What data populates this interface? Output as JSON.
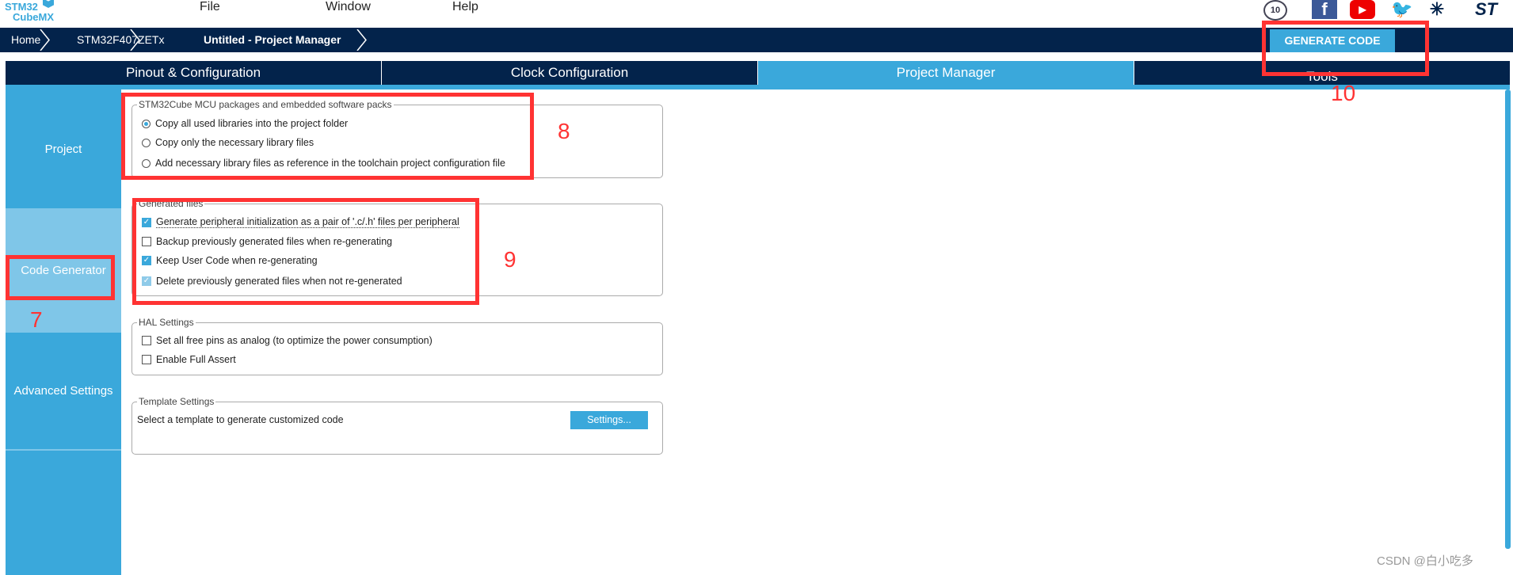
{
  "app": {
    "logo_line1": "STM32",
    "logo_line2": "CubeMX"
  },
  "menu": [
    "File",
    "Window",
    "Help"
  ],
  "social_icons": [
    "anniversary-10-years-icon",
    "facebook-icon",
    "youtube-icon",
    "twitter-icon",
    "network-icon",
    "st-logo-icon"
  ],
  "breadcrumb": [
    "Home",
    "STM32F407ZETx",
    "Untitled - Project Manager"
  ],
  "generate_code_label": "GENERATE CODE",
  "tabs": [
    {
      "label": "Pinout & Configuration",
      "active": false
    },
    {
      "label": "Clock Configuration",
      "active": false
    },
    {
      "label": "Project Manager",
      "active": true
    },
    {
      "label": "Tools",
      "active": false
    }
  ],
  "sidebar": [
    {
      "label": "Project",
      "active": false
    },
    {
      "label": "Code Generator",
      "active": true
    },
    {
      "label": "Advanced Settings",
      "active": false
    }
  ],
  "groups": {
    "packages": {
      "title": "STM32Cube MCU packages and embedded software packs",
      "options": [
        {
          "label": "Copy all used libraries into the project folder",
          "selected": true
        },
        {
          "label": "Copy only the necessary library files",
          "selected": false
        },
        {
          "label": "Add necessary library files as reference in the toolchain project configuration file",
          "selected": false
        }
      ]
    },
    "generated": {
      "title": "Generated files",
      "options": [
        {
          "label": "Generate peripheral initialization as a pair of '.c/.h' files per peripheral",
          "checked": true
        },
        {
          "label": "Backup previously generated files when re-generating",
          "checked": false
        },
        {
          "label": "Keep User Code when re-generating",
          "checked": true
        },
        {
          "label": "Delete previously generated files when not re-generated",
          "checked": true,
          "disabled": true
        }
      ]
    },
    "hal": {
      "title": "HAL Settings",
      "options": [
        {
          "label": "Set all free pins as analog (to optimize the power consumption)",
          "checked": false
        },
        {
          "label": "Enable Full Assert",
          "checked": false
        }
      ]
    },
    "template": {
      "title": "Template Settings",
      "text": "Select a template to generate customized code",
      "button": "Settings..."
    }
  },
  "annotations": [
    "7",
    "8",
    "9",
    "10"
  ],
  "watermark": "CSDN @白小吃多",
  "colors": {
    "navy": "#03234b",
    "accent": "#3aa8db",
    "active_side": "#7fc6e8",
    "annotation": "#ff3333"
  }
}
